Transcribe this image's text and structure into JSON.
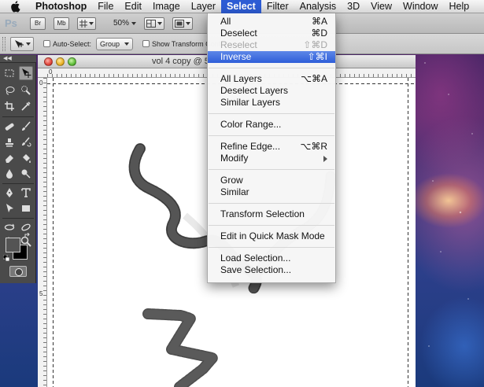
{
  "menubar": {
    "app_name": "Photoshop",
    "items": [
      "File",
      "Edit",
      "Image",
      "Layer",
      "Select",
      "Filter",
      "Analysis",
      "3D",
      "View",
      "Window",
      "Help"
    ],
    "active_item": "Select"
  },
  "appbar": {
    "logo": "Ps",
    "bridge_btn": "Br",
    "minibridge_btn": "Mb",
    "zoom": "50%"
  },
  "options_bar": {
    "auto_select_label": "Auto-Select:",
    "auto_select_value": "Group",
    "show_transform_label": "Show Transform Controls"
  },
  "document": {
    "title": "vol 4 copy @ 5",
    "ruler_top_label": "0",
    "ruler_left_labels": [
      "0",
      "5"
    ]
  },
  "select_menu": {
    "groups": [
      [
        {
          "label": "All",
          "shortcut": "⌘A",
          "enabled": true,
          "highlighted": false
        },
        {
          "label": "Deselect",
          "shortcut": "⌘D",
          "enabled": true,
          "highlighted": false
        },
        {
          "label": "Reselect",
          "shortcut": "⇧⌘D",
          "enabled": false,
          "highlighted": false
        },
        {
          "label": "Inverse",
          "shortcut": "⇧⌘I",
          "enabled": true,
          "highlighted": true
        }
      ],
      [
        {
          "label": "All Layers",
          "shortcut": "⌥⌘A",
          "enabled": true,
          "highlighted": false
        },
        {
          "label": "Deselect Layers",
          "shortcut": "",
          "enabled": true,
          "highlighted": false
        },
        {
          "label": "Similar Layers",
          "shortcut": "",
          "enabled": true,
          "highlighted": false
        }
      ],
      [
        {
          "label": "Color Range...",
          "shortcut": "",
          "enabled": true,
          "highlighted": false
        }
      ],
      [
        {
          "label": "Refine Edge...",
          "shortcut": "⌥⌘R",
          "enabled": true,
          "highlighted": false
        },
        {
          "label": "Modify",
          "shortcut": "",
          "enabled": true,
          "highlighted": false,
          "submenu": true
        }
      ],
      [
        {
          "label": "Grow",
          "shortcut": "",
          "enabled": true,
          "highlighted": false
        },
        {
          "label": "Similar",
          "shortcut": "",
          "enabled": true,
          "highlighted": false
        }
      ],
      [
        {
          "label": "Transform Selection",
          "shortcut": "",
          "enabled": true,
          "highlighted": false
        }
      ],
      [
        {
          "label": "Edit in Quick Mask Mode",
          "shortcut": "",
          "enabled": true,
          "highlighted": false
        }
      ],
      [
        {
          "label": "Load Selection...",
          "shortcut": "",
          "enabled": true,
          "highlighted": false
        },
        {
          "label": "Save Selection...",
          "shortcut": "",
          "enabled": true,
          "highlighted": false
        }
      ]
    ]
  },
  "colors": {
    "menu_highlight": "#2e5ed9",
    "foreground_swatch": "#545454",
    "background_swatch": "#000000"
  }
}
